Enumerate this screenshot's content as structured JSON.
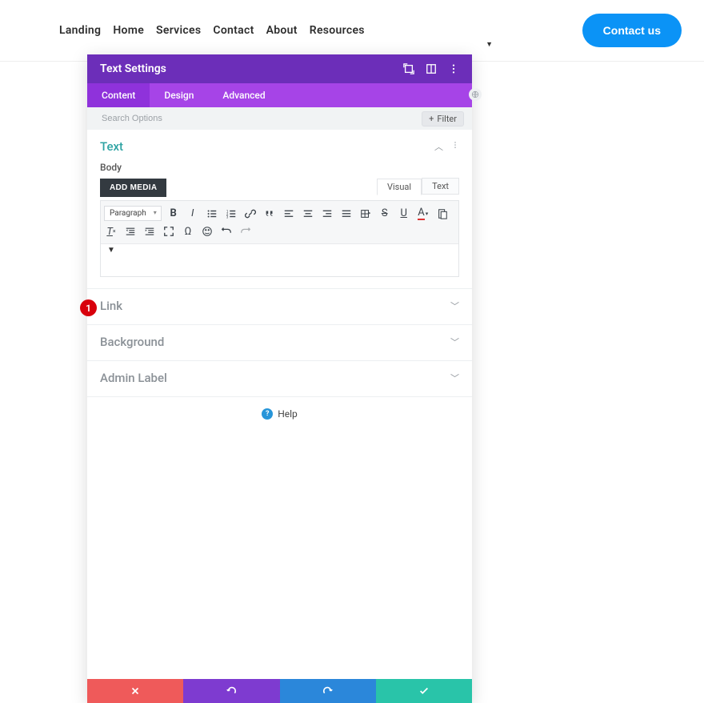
{
  "nav": {
    "items": [
      "Landing",
      "Home",
      "Services",
      "Contact",
      "About",
      "Resources"
    ],
    "cta": "Contact us"
  },
  "modal": {
    "title": "Text Settings",
    "tabs": [
      "Content",
      "Design",
      "Advanced"
    ],
    "search_placeholder": "Search Options",
    "filter_label": "Filter"
  },
  "text_section": {
    "title": "Text",
    "body_label": "Body",
    "add_media": "ADD MEDIA",
    "editor_tabs": [
      "Visual",
      "Text"
    ],
    "format": "Paragraph"
  },
  "sections": {
    "link": "Link",
    "background": "Background",
    "admin_label": "Admin Label"
  },
  "help": "Help",
  "callout": "1"
}
